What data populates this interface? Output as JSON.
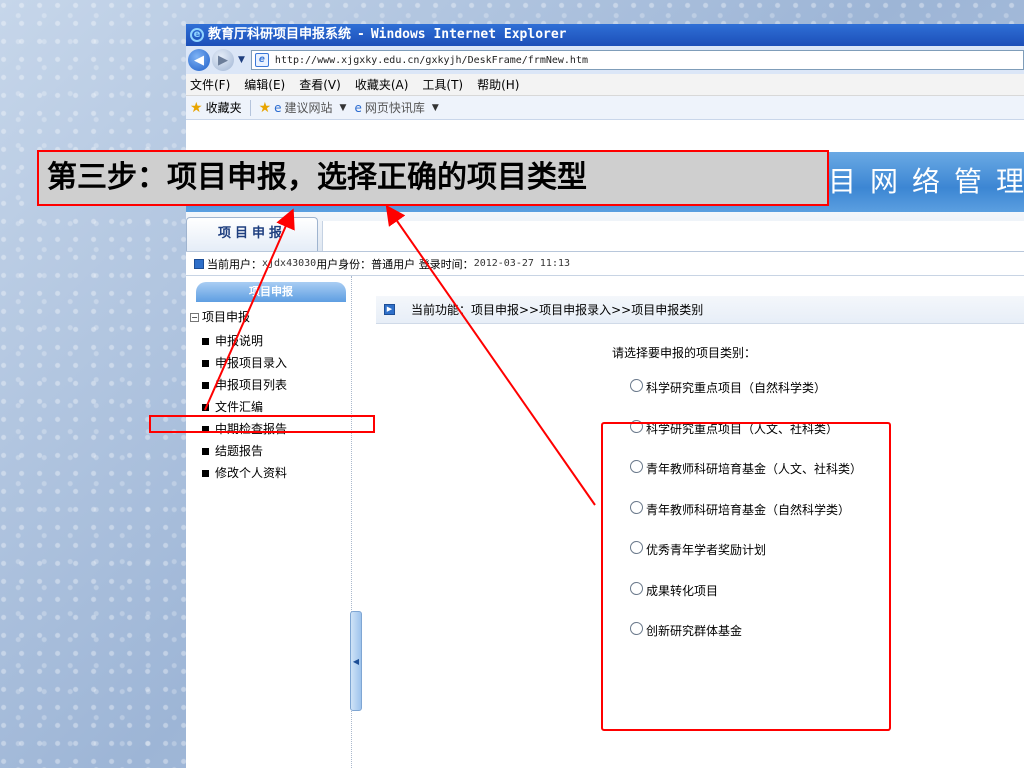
{
  "window": {
    "title_app": "教育厅科研项目申报系统",
    "title_sep": "-",
    "title_browser": "Windows Internet Explorer",
    "url": "http://www.xjgxky.edu.cn/gxkyjh/DeskFrame/frmNew.htm"
  },
  "menu": [
    "文件(F)",
    "编辑(E)",
    "查看(V)",
    "收藏夹(A)",
    "工具(T)",
    "帮助(H)"
  ],
  "favorites": {
    "label": "收藏夹",
    "suggested": "建议网站",
    "slices": "网页快讯库"
  },
  "site": {
    "banner": "新疆维吾尔自治区高校科研计划项目网络管理平台",
    "nav_tab": "项目申报",
    "user_label": "当前用户：",
    "user_id": "xjdx43030",
    "role_text": "用户身份：普通用户 登录时间：",
    "login_time": "2012-03-27 11:13"
  },
  "sidebar": {
    "header": "项目申报",
    "root": "项目申报",
    "items": [
      "申报说明",
      "申报项目录入",
      "申报项目列表",
      "文件汇编",
      "中期检查报告",
      "结题报告",
      "修改个人资料"
    ]
  },
  "main": {
    "breadcrumb": "当前功能：项目申报>>项目申报录入>>项目申报类别",
    "prompt": "请选择要申报的项目类别：",
    "options": [
      "科学研究重点项目（自然科学类）",
      "科学研究重点项目（人文、社科类）",
      "青年教师科研培育基金（人文、社科类）",
      "青年教师科研培育基金（自然科学类）",
      "优秀青年学者奖励计划",
      "成果转化项目",
      "创新研究群体基金"
    ]
  },
  "annotation": {
    "step_text": "第三步：项目申报，选择正确的项目类型",
    "color": "#ff0000"
  }
}
